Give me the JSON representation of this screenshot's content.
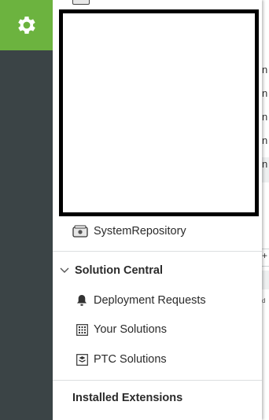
{
  "panel": {
    "system_repository": "SystemRepository",
    "solution_central": {
      "title": "Solution Central",
      "items": [
        {
          "label": "Deployment Requests",
          "icon": "bell-icon"
        },
        {
          "label": "Your Solutions",
          "icon": "grid-icon"
        },
        {
          "label": "PTC Solutions",
          "icon": "solution-package-icon"
        }
      ]
    },
    "installed_extensions": "Installed Extensions"
  },
  "background": {
    "fragments": [
      "n",
      "n",
      "n",
      "n",
      "n"
    ],
    "plus": "+",
    "small": "d"
  },
  "colors": {
    "rail": "#3b4446",
    "accent_green": "#6cb33f"
  }
}
